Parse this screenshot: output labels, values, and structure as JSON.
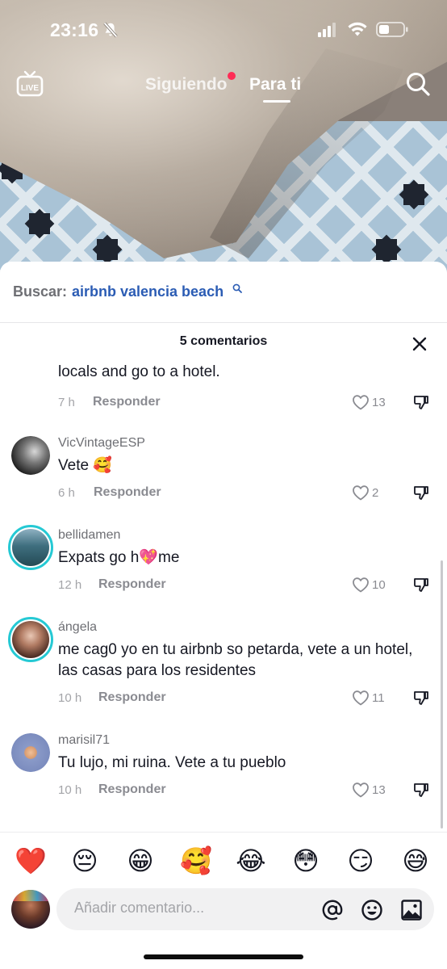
{
  "status_bar": {
    "time": "23:16",
    "icons": [
      "bell-slash-icon",
      "cellular-signal-icon",
      "wifi-icon",
      "battery-icon"
    ]
  },
  "top_nav": {
    "live_icon": "live-tv-icon",
    "tabs": [
      {
        "label": "Siguiendo",
        "active": false,
        "has_notification_dot": true
      },
      {
        "label": "Para ti",
        "active": true
      }
    ],
    "search_icon": "search-icon"
  },
  "search_suggestion": {
    "prefix": "Buscar:",
    "term": "airbnb valencia beach"
  },
  "comments_panel": {
    "title": "5 comentarios",
    "close_icon": "close-icon",
    "reply_label": "Responder",
    "comments": [
      {
        "username": "",
        "text": "locals and go to a hotel.",
        "time": "7 h",
        "likes": "13"
      },
      {
        "username": "VicVintageESP",
        "text": "Vete 🥰",
        "time": "6 h",
        "likes": "2"
      },
      {
        "username": "bellidamen",
        "text": "Expats go h💖me",
        "time": "12 h",
        "likes": "10"
      },
      {
        "username": "ángela",
        "text": "me cag0 yo en tu airbnb so petarda, vete a un hotel, las casas para los residentes",
        "time": "10 h",
        "likes": "11"
      },
      {
        "username": "marisil71",
        "text": "Tu lujo, mi ruina. Vete a tu pueblo",
        "time": "10 h",
        "likes": "13"
      }
    ]
  },
  "emoji_bar": [
    "❤️",
    "😔",
    "😁",
    "🥰",
    "😂",
    "😳",
    "😏",
    "😅"
  ],
  "composer": {
    "placeholder": "Añadir comentario...",
    "icons": [
      "at-mention-icon",
      "emoji-icon",
      "image-icon"
    ]
  },
  "colors": {
    "accent_red": "#fe2c55",
    "link_blue": "#2b5cb4",
    "story_ring": "#25c9d4"
  }
}
